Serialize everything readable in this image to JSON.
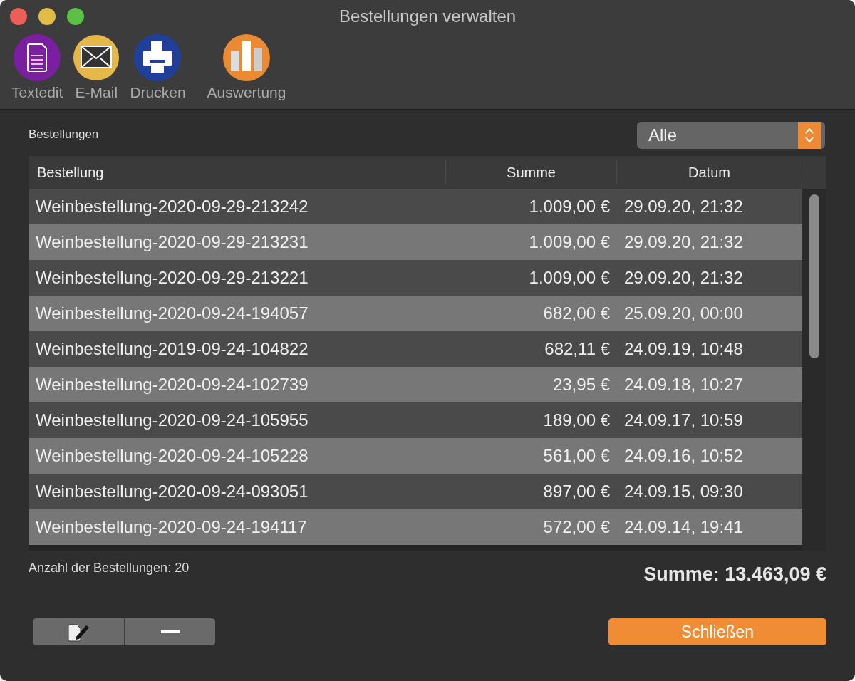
{
  "window": {
    "title": "Bestellungen verwalten"
  },
  "toolbar": [
    {
      "kind": "textedit",
      "label": "Textedit"
    },
    {
      "kind": "mail",
      "label": "E-Mail"
    },
    {
      "kind": "print",
      "label": "Drucken"
    },
    {
      "kind": "chart",
      "label": "Auswertung"
    }
  ],
  "filter": {
    "value": "Alle"
  },
  "section_label": "Bestellungen",
  "table": {
    "columns": [
      "Bestellung",
      "Summe",
      "Datum"
    ],
    "rows": [
      [
        "Weinbestellung-2020-09-29-213242",
        "1.009,00 €",
        "29.09.20, 21:32"
      ],
      [
        "Weinbestellung-2020-09-29-213231",
        "1.009,00 €",
        "29.09.20, 21:32"
      ],
      [
        "Weinbestellung-2020-09-29-213221",
        "1.009,00 €",
        "29.09.20, 21:32"
      ],
      [
        "Weinbestellung-2020-09-24-194057",
        "682,00 €",
        "25.09.20, 00:00"
      ],
      [
        "Weinbestellung-2019-09-24-104822",
        "682,11 €",
        "24.09.19, 10:48"
      ],
      [
        "Weinbestellung-2020-09-24-102739",
        "23,95 €",
        "24.09.18, 10:27"
      ],
      [
        "Weinbestellung-2020-09-24-105955",
        "189,00 €",
        "24.09.17, 10:59"
      ],
      [
        "Weinbestellung-2020-09-24-105228",
        "561,00 €",
        "24.09.16, 10:52"
      ],
      [
        "Weinbestellung-2020-09-24-093051",
        "897,00 €",
        "24.09.15, 09:30"
      ],
      [
        "Weinbestellung-2020-09-24-194117",
        "572,00 €",
        "24.09.14, 19:41"
      ]
    ]
  },
  "count": "Anzahl der Bestellungen: 20",
  "total": "Summe: 13.463,09 €",
  "close_button": "Schließen"
}
